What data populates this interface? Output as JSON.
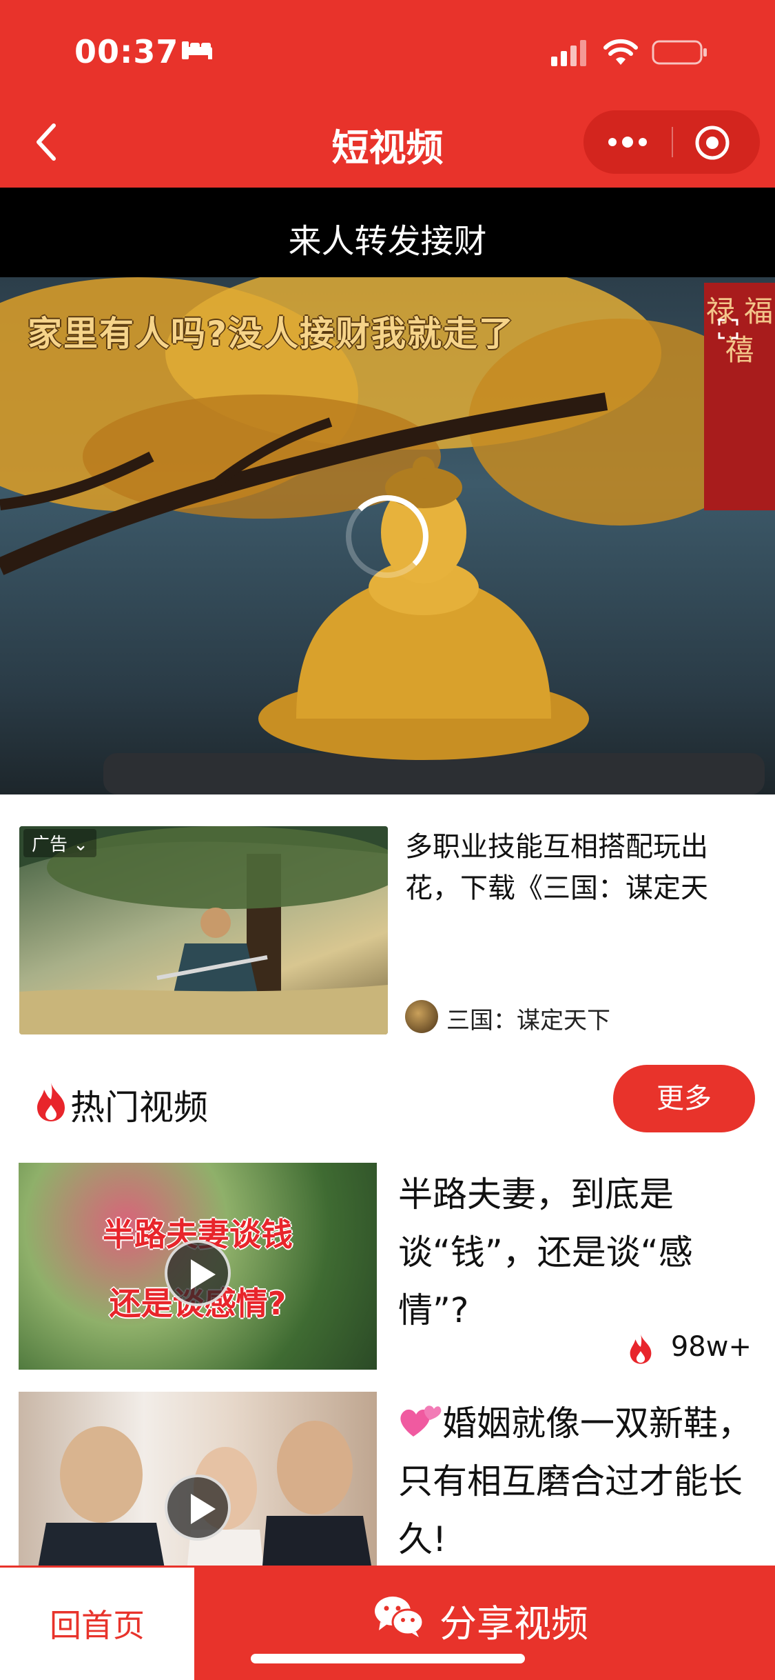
{
  "status_bar": {
    "time": "00:37"
  },
  "nav": {
    "title": "短视频"
  },
  "banner": {
    "text": "来人转发接财"
  },
  "video": {
    "caption": "家里有人吗?没人接财我就走了",
    "scroll_text": "禄 福 禧"
  },
  "ad": {
    "badge": "广告",
    "title": "多职业技能互相搭配玩出花，下载《三国：谋定天",
    "brand": "三国：谋定天下"
  },
  "hot_section": {
    "title": "热门视频",
    "more_label": "更多"
  },
  "videos": [
    {
      "thumb_line1": "半路夫妻谈钱",
      "thumb_line2": "还是谈感情?",
      "title": "半路夫妻，到底是谈“钱”，还是谈“感情”?",
      "views": "98w+"
    },
    {
      "title": "婚姻就像一双新鞋，只有相互磨合过才能长久!"
    }
  ],
  "bottom": {
    "home_label": "回首页",
    "share_label": "分享视频"
  },
  "colors": {
    "brand_red": "#e8332b"
  }
}
